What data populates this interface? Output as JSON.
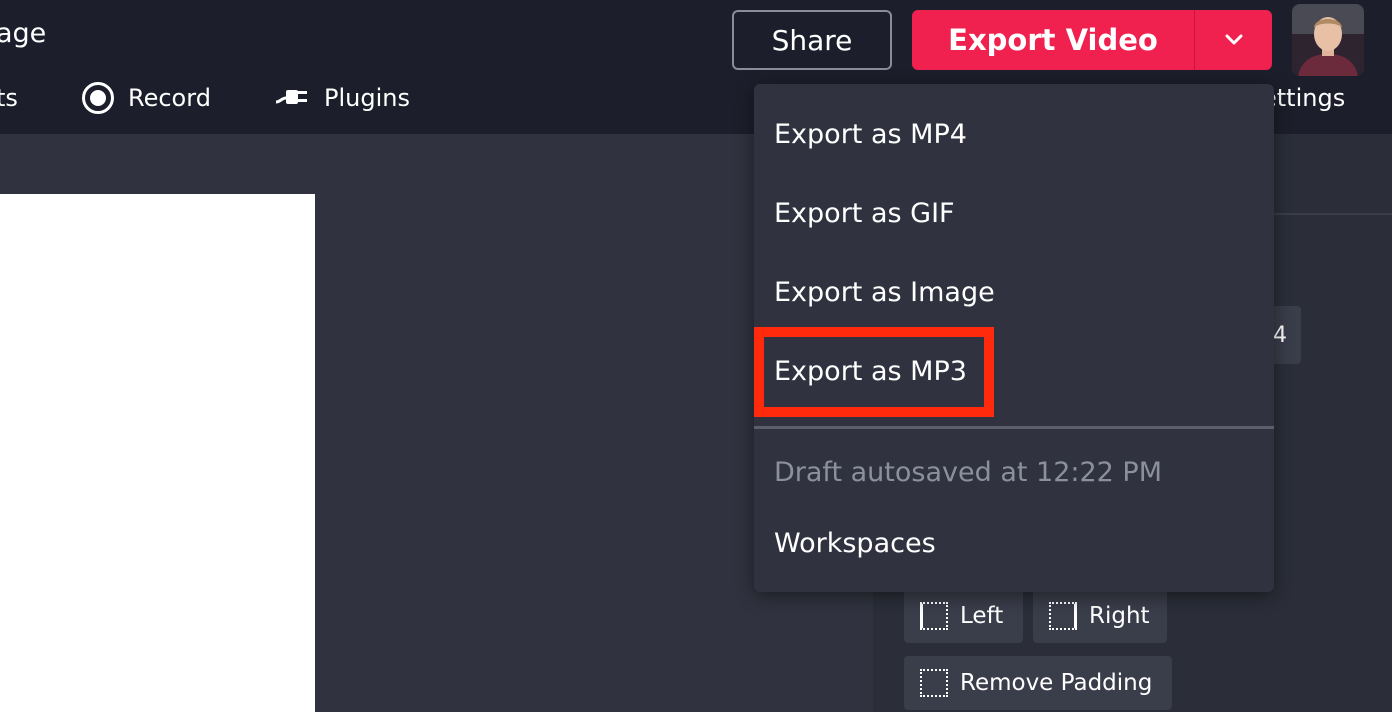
{
  "header": {
    "project_title": "age",
    "share_label": "Share",
    "export_label": "Export Video",
    "export_color": "#f0204f"
  },
  "toolbar": {
    "items": [
      {
        "label": "ts"
      },
      {
        "label": "Record",
        "icon": "record-icon"
      },
      {
        "label": "Plugins",
        "icon": "plug-icon"
      },
      {
        "label": "ettings"
      }
    ]
  },
  "export_menu": {
    "items": [
      {
        "label": "Export as MP4"
      },
      {
        "label": "Export as GIF"
      },
      {
        "label": "Export as Image"
      },
      {
        "label": "Export as MP3",
        "highlighted": true
      }
    ],
    "status": "Draft autosaved at 12:22 PM",
    "workspaces_label": "Workspaces",
    "highlight_color": "#ff2a0b"
  },
  "right_panel": {
    "number_value": "4",
    "padding_buttons": [
      {
        "label": "Left"
      },
      {
        "label": "Right"
      },
      {
        "label": "Remove Padding"
      }
    ]
  }
}
